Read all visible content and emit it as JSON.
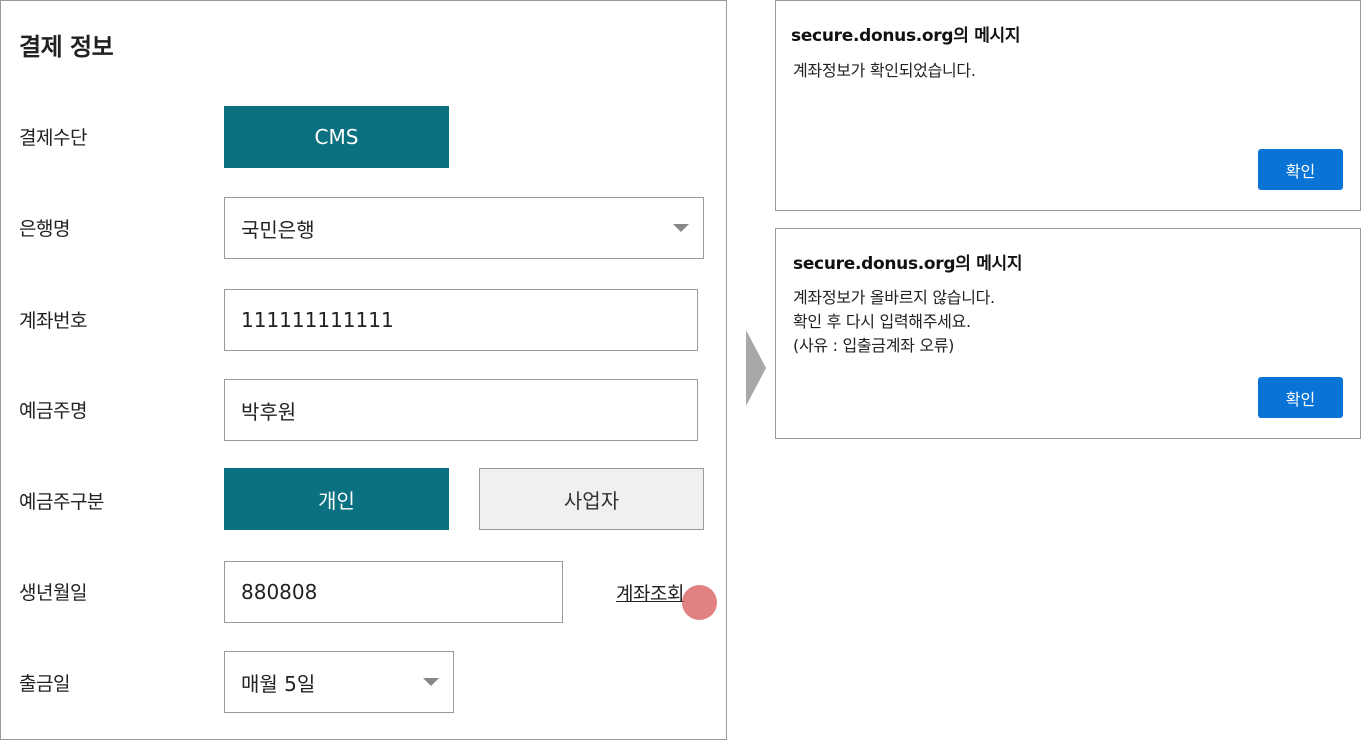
{
  "form": {
    "title": "결제 정보",
    "payment_method": {
      "label": "결제수단",
      "option": "CMS"
    },
    "bank": {
      "label": "은행명",
      "selected": "국민은행"
    },
    "account_number": {
      "label": "계좌번호",
      "value": "111111111111"
    },
    "account_holder": {
      "label": "예금주명",
      "value": "박후원"
    },
    "holder_type": {
      "label": "예금주구분",
      "options": [
        "개인",
        "사업자"
      ],
      "selected": "개인"
    },
    "birthdate": {
      "label": "생년월일",
      "value": "880808",
      "lookup_link": "계좌조회"
    },
    "withdrawal_day": {
      "label": "출금일",
      "selected": "매월 5일"
    }
  },
  "dialog_success": {
    "title": "secure.donus.org의 메시지",
    "message": "계좌정보가 확인되었습니다.",
    "ok_label": "확인"
  },
  "dialog_error": {
    "title": "secure.donus.org의 메시지",
    "message_lines": [
      "계좌정보가 올바르지 않습니다.",
      "확인 후 다시 입력해주세요.",
      "(사유 : 입출금계좌 오류)"
    ],
    "ok_label": "확인"
  },
  "colors": {
    "active_button": "#0b7080",
    "dialog_button": "#0a74d6",
    "click_indicator": "#d65050"
  }
}
